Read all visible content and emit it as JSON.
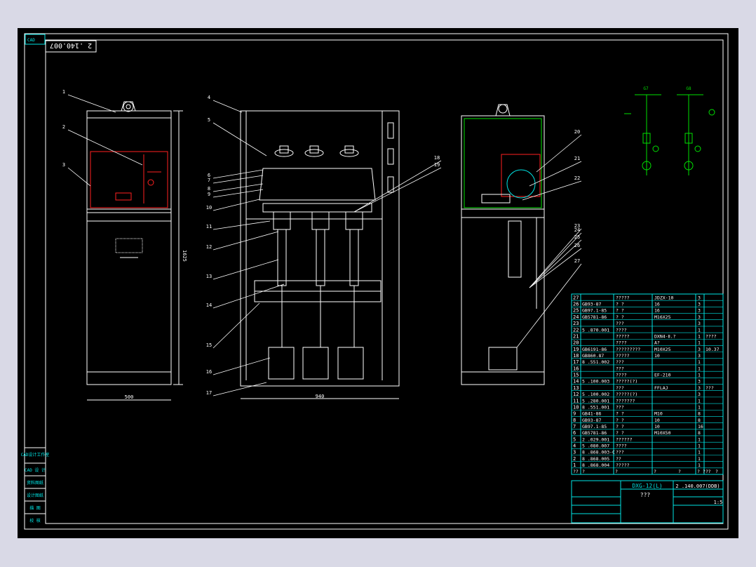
{
  "drawing": {
    "title": "DXG-12(L)",
    "code": "2 .140.007(DDB)",
    "code_mirrored": "2 .140.007",
    "subtitle": "???",
    "scale": "1:5",
    "front_width": "500",
    "front_height": "1625",
    "mid_width": "940"
  },
  "side_labels": [
    "CAD设计工作室",
    "CAD 设 计",
    "资料图纸",
    "设计图纸",
    "描 图",
    "校 核"
  ],
  "callouts": [
    "1",
    "2",
    "3",
    "4",
    "5",
    "6",
    "7",
    "8",
    "9",
    "10",
    "11",
    "12",
    "13",
    "14",
    "15",
    "16",
    "17",
    "18",
    "19",
    "20",
    "21",
    "22",
    "23",
    "24",
    "25",
    "26",
    "27"
  ],
  "schematic": {
    "left": "G7",
    "right": "G8"
  },
  "bom": [
    {
      "no": "27",
      "code": "",
      "name": "?????",
      "spec": "JDZX-10",
      "qty": "3",
      "note": ""
    },
    {
      "no": "26",
      "code": "GB93-87",
      "name": "? ?",
      "spec": "16",
      "qty": "3",
      "note": ""
    },
    {
      "no": "25",
      "code": "GB97.1-85",
      "name": "? ?",
      "spec": "16",
      "qty": "3",
      "note": ""
    },
    {
      "no": "24",
      "code": "GB5781-86",
      "name": "? ?",
      "spec": "M16X25",
      "qty": "3",
      "note": ""
    },
    {
      "no": "23",
      "code": "",
      "name": "???",
      "spec": "",
      "qty": "3",
      "note": ""
    },
    {
      "no": "22",
      "code": "5 .870.001",
      "name": "????",
      "spec": "",
      "qty": "1",
      "note": ""
    },
    {
      "no": "21",
      "code": "",
      "name": "?????",
      "spec": "DXN4-Ⅱ.?",
      "qty": "1",
      "note": "????"
    },
    {
      "no": "20",
      "code": "",
      "name": "????",
      "spec": "A?",
      "qty": "1",
      "note": ""
    },
    {
      "no": "19",
      "code": "GB6191-86",
      "name": "?????????",
      "spec": "M10X25",
      "qty": "3",
      "note": "10.37"
    },
    {
      "no": "18",
      "code": "GB860.87",
      "name": "?????",
      "spec": "10",
      "qty": "3",
      "note": ""
    },
    {
      "no": "17",
      "code": "8 .551.002",
      "name": "???",
      "spec": "",
      "qty": "1",
      "note": ""
    },
    {
      "no": "16",
      "code": "",
      "name": "???",
      "spec": "",
      "qty": "1",
      "note": ""
    },
    {
      "no": "15",
      "code": "",
      "name": "????",
      "spec": "EF-210",
      "qty": "1",
      "note": ""
    },
    {
      "no": "14",
      "code": "5 .100.003",
      "name": "?????(?)",
      "spec": "",
      "qty": "3",
      "note": ""
    },
    {
      "no": "13",
      "code": "",
      "name": "???",
      "spec": "FFLAJ",
      "qty": "3",
      "note": "???"
    },
    {
      "no": "12",
      "code": "5 .100.002",
      "name": "?????(?)",
      "spec": "",
      "qty": "3",
      "note": ""
    },
    {
      "no": "11",
      "code": "5 .280.001",
      "name": "???????",
      "spec": "",
      "qty": "1",
      "note": ""
    },
    {
      "no": "10",
      "code": "8 .551.001",
      "name": "???",
      "spec": "",
      "qty": "1",
      "note": ""
    },
    {
      "no": "9",
      "code": "GB41-86",
      "name": "? ?",
      "spec": "M10",
      "qty": "8",
      "note": ""
    },
    {
      "no": "8",
      "code": "GB93-87",
      "name": "? ?",
      "spec": "10",
      "qty": "8",
      "note": ""
    },
    {
      "no": "7",
      "code": "GB97.1-85",
      "name": "? ?",
      "spec": "10",
      "qty": "16",
      "note": ""
    },
    {
      "no": "6",
      "code": "GB5781-86",
      "name": "? ?",
      "spec": "M10X50",
      "qty": "8",
      "note": ""
    },
    {
      "no": "5",
      "code": "2 .029.001",
      "name": "??????",
      "spec": "",
      "qty": "1",
      "note": ""
    },
    {
      "no": "4",
      "code": "5 .080.007",
      "name": "????",
      "spec": "",
      "qty": "1",
      "note": ""
    },
    {
      "no": "3",
      "code": "8 .868.003-C",
      "name": "???",
      "spec": "",
      "qty": "1",
      "note": ""
    },
    {
      "no": "2",
      "code": "8 .868.005",
      "name": "??",
      "spec": "",
      "qty": "1",
      "note": ""
    },
    {
      "no": "1",
      "code": "8 .868.004",
      "name": "?????",
      "spec": "",
      "qty": "1",
      "note": ""
    }
  ],
  "bom_header": [
    "??",
    "?",
    "?",
    "?",
    "?",
    "? ? ?",
    "?",
    "?"
  ],
  "colors": {
    "line": "#ffffff",
    "accent": "#00e5e5",
    "red": "#ff2020",
    "green": "#00e000",
    "page": "#d9d9e6",
    "sheet": "#000000"
  }
}
